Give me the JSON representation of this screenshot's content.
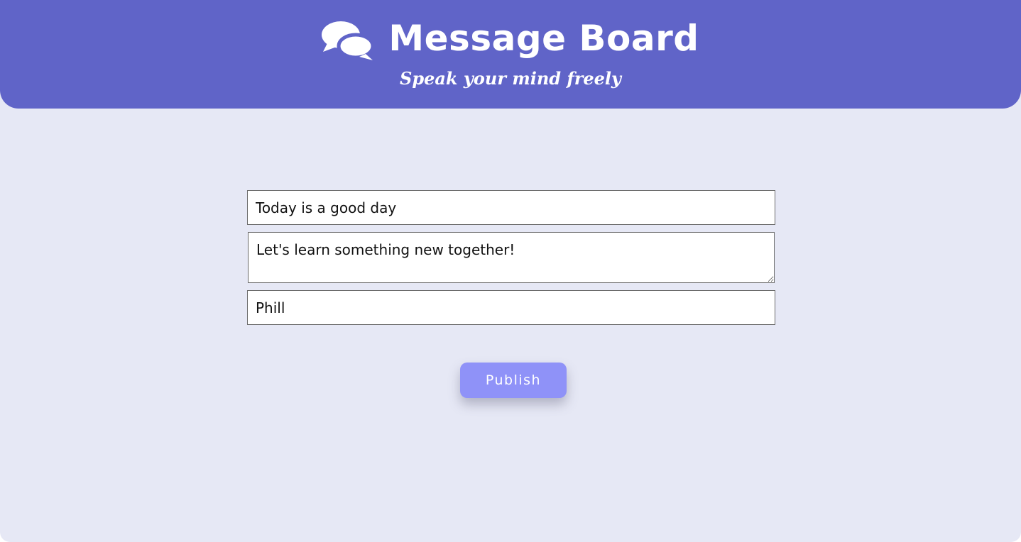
{
  "header": {
    "icon": "comments-icon",
    "title": "Message Board",
    "subtitle": "Speak your mind freely"
  },
  "form": {
    "title_value": "Today is a good day",
    "message_value": "Let's learn something new together!",
    "author_value": "Phill",
    "publish_label": "Publish"
  },
  "colors": {
    "header_background": "#6064c8",
    "page_background": "#e6e8f5",
    "button_background": "#8f92f8",
    "text_on_accent": "#ffffff"
  }
}
